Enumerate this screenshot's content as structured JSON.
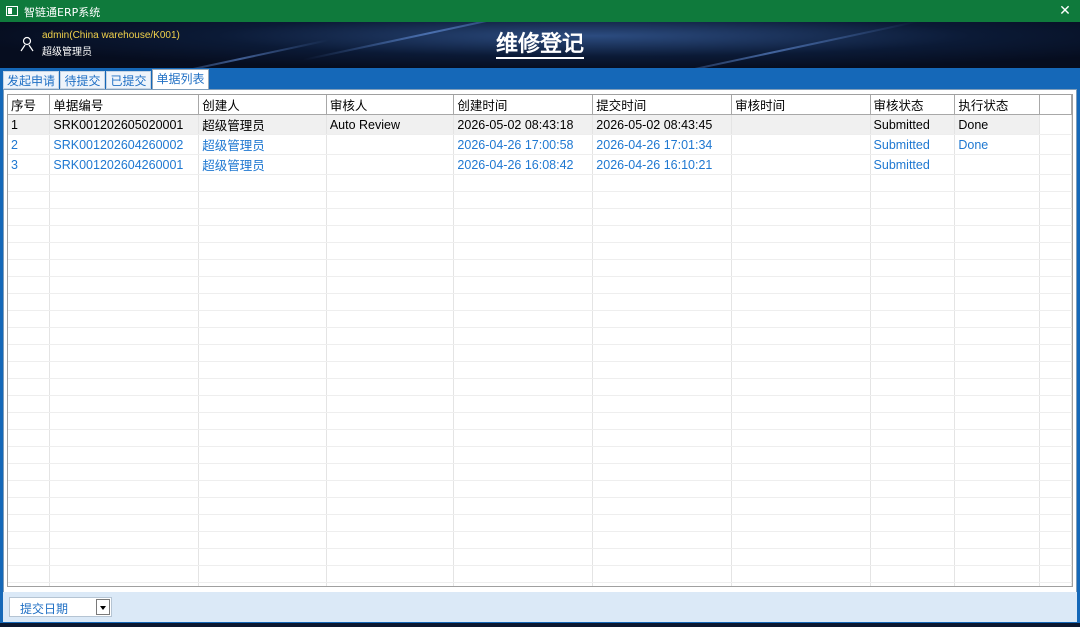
{
  "window": {
    "title": "智链通ERP系统",
    "close_glyph": "✕"
  },
  "header": {
    "user_account": "admin(China warehouse/K001)",
    "user_role": "超级管理员",
    "page_title": "维修登记"
  },
  "tabs": [
    {
      "label": "发起申请",
      "active": false
    },
    {
      "label": "待提交",
      "active": false
    },
    {
      "label": "已提交",
      "active": false
    },
    {
      "label": "单据列表",
      "active": true
    }
  ],
  "table": {
    "columns": [
      "序号",
      "单据编号",
      "创建人",
      "审核人",
      "创建时间",
      "提交时间",
      "审核时间",
      "审核状态",
      "执行状态"
    ],
    "rows": [
      [
        "1",
        "SRK001202605020001",
        "超级管理员",
        "Auto Review",
        "2026-05-02 08:43:18",
        "2026-05-02 08:43:45",
        "",
        "Submitted",
        "Done"
      ],
      [
        "2",
        "SRK001202604260002",
        "超级管理员",
        "",
        "2026-04-26 17:00:58",
        "2026-04-26 17:01:34",
        "",
        "Submitted",
        "Done"
      ],
      [
        "3",
        "SRK001202604260001",
        "超级管理员",
        "",
        "2026-04-26 16:08:42",
        "2026-04-26 16:10:21",
        "",
        "Submitted",
        ""
      ]
    ],
    "selected_row": 0
  },
  "footer": {
    "date_filter": "提交日期"
  },
  "colors": {
    "titlebar": "#0f7a3c",
    "frame": "#1568b8",
    "link_text": "#1f78d1",
    "user_account": "#f2d24b"
  },
  "icons": {
    "user": "user-icon",
    "dropdown": "chevron-down-icon",
    "close": "close-icon"
  }
}
